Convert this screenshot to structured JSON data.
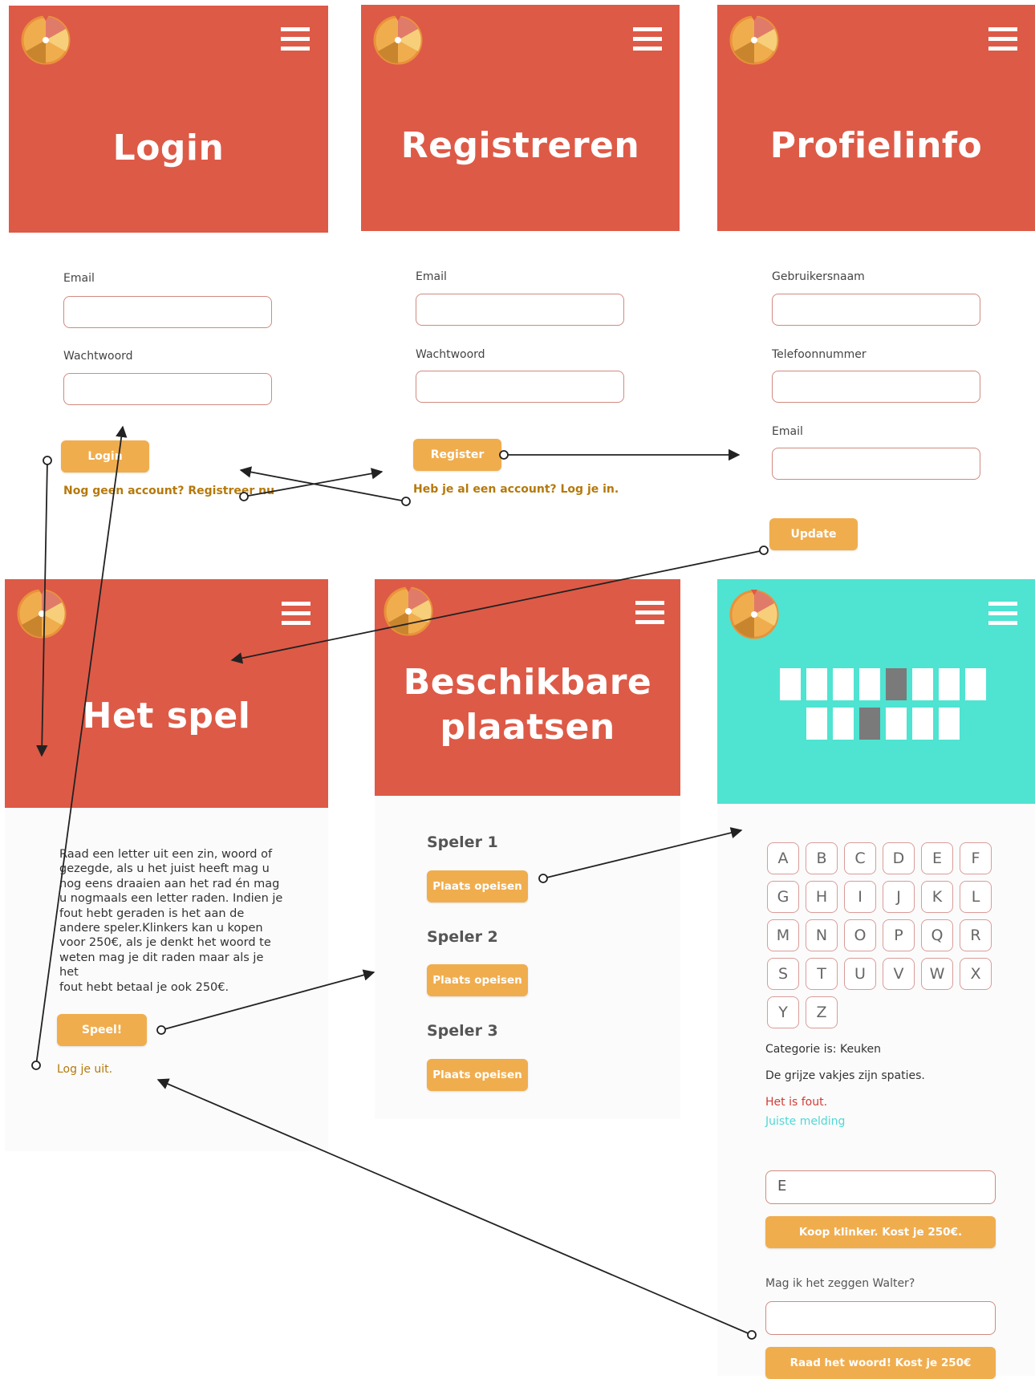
{
  "login": {
    "title": "Login",
    "email_label": "Email",
    "password_label": "Wachtwoord",
    "button": "Login",
    "link": "Nog geen account? Registreer nu"
  },
  "register": {
    "title": "Registreren",
    "email_label": "Email",
    "password_label": "Wachtwoord",
    "button": "Register",
    "link": "Heb je al een account? Log je in."
  },
  "profile": {
    "title": "Profielinfo",
    "username_label": "Gebruikersnaam",
    "phone_label": "Telefoonnummer",
    "email_label": "Email",
    "button": "Update"
  },
  "game": {
    "title": "Het spel",
    "paragraph_lines": [
      "Raad een letter uit een zin, woord of",
      "gezegde, als u het juist heeft mag u",
      "nog eens draaien aan het rad én mag",
      "u nogmaals een letter raden.  Indien je",
      "fout hebt geraden is het aan de",
      "andere speler.Klinkers kan u kopen",
      "voor 250€, als je denkt het woord te",
      "weten mag je dit raden maar als je het",
      "fout hebt betaal je ook 250€."
    ],
    "button": "Speel!",
    "logout": "Log je uit."
  },
  "places": {
    "title_line1": "Beschikbare",
    "title_line2": "plaatsen",
    "players": [
      {
        "name": "Speler 1",
        "button": "Plaats opeisen"
      },
      {
        "name": "Speler 2",
        "button": "Plaats opeisen"
      },
      {
        "name": "Speler 3",
        "button": "Plaats opeisen"
      }
    ]
  },
  "board": {
    "letters": [
      "A",
      "B",
      "C",
      "D",
      "E",
      "F",
      "G",
      "H",
      "I",
      "J",
      "K",
      "L",
      "M",
      "N",
      "O",
      "P",
      "Q",
      "R",
      "S",
      "T",
      "U",
      "V",
      "W",
      "X",
      "Y",
      "Z"
    ],
    "category": "Categorie is: Keuken",
    "spaces_hint": "De grijze vakjes zijn spaties.",
    "wrong_msg": "Het is fout.",
    "right_msg": "Juiste melding",
    "letter_input_value": "E",
    "buy_vowel_button": "Koop klinker. Kost je 250€.",
    "guess_label": "Mag ik het zeggen Walter?",
    "guess_button": "Raad het woord! Kost je 250€"
  },
  "colors": {
    "header_red": "#dd5a47",
    "header_teal": "#4fe3d1",
    "button_orange": "#f0ad4e",
    "link_brown": "#b5790b"
  },
  "icons": [
    "wheel-logo-icon",
    "hamburger-menu-icon"
  ]
}
